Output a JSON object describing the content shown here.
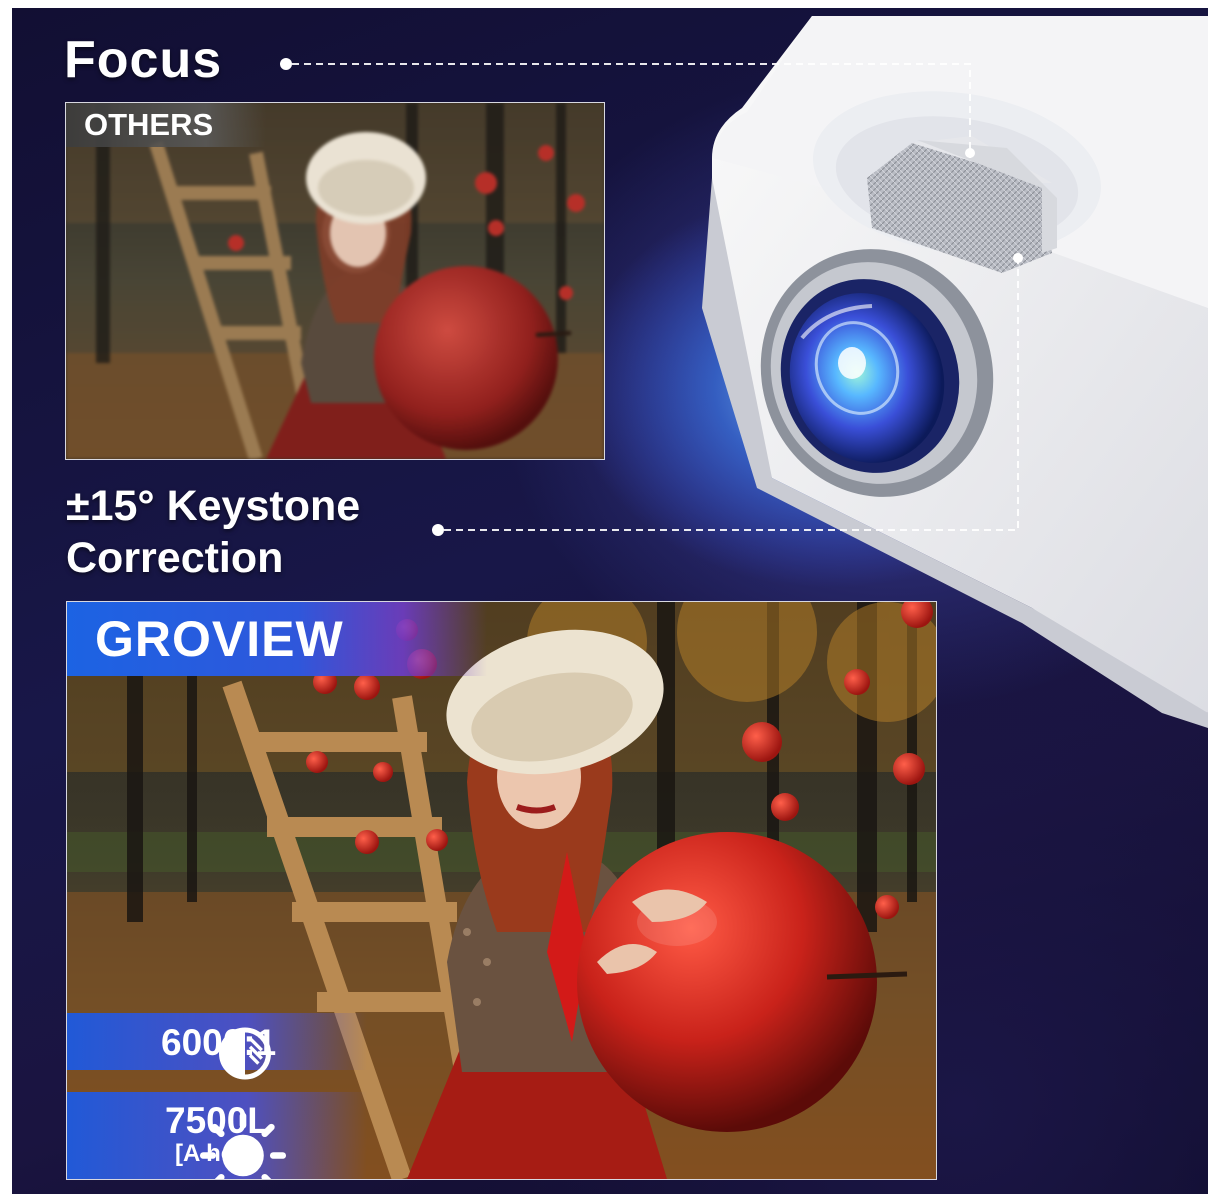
{
  "headings": {
    "focus": "Focus",
    "keystone_line1": "±15° Keystone",
    "keystone_line2": "Correction"
  },
  "comparison": {
    "others_label": "OTHERS",
    "brand_label": "GROVIEW"
  },
  "specs": {
    "contrast_value": "6000:1",
    "contrast_icon": "contrast-icon",
    "brightness_value": "7500L",
    "brightness_note": "[A hoy]",
    "brightness_icon": "sun-icon"
  },
  "colors": {
    "background": "#15123d",
    "brand_blue": "#1c63e3",
    "others_gray": "#4a4a4a"
  }
}
